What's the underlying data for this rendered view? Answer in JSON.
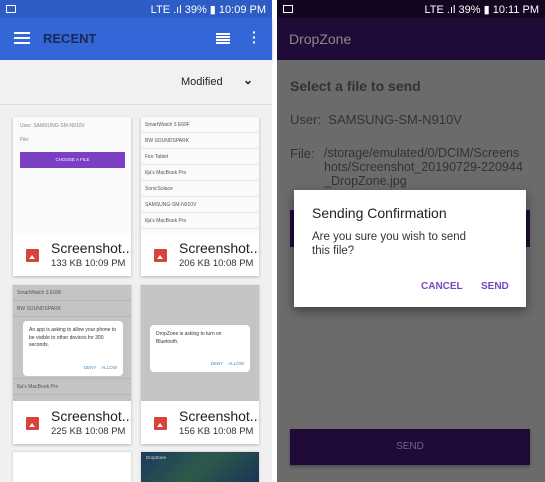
{
  "left": {
    "status": {
      "time": "10:09 PM",
      "battery": "39%",
      "network": "LTE"
    },
    "toolbar": {
      "title": "RECENT",
      "menu_icon": "hamburger-icon",
      "view_icon": "list-view-icon",
      "more_icon": "more-vert-icon"
    },
    "sort": {
      "label": "Modified"
    },
    "files": [
      {
        "name": "Screenshot...",
        "size": "133 KB",
        "time": "10:09 PM",
        "thumb": {
          "user": "User:",
          "user_value": "SAMSUNG-SM-N910V",
          "file": "File:",
          "button": "CHOOSE A FILE"
        }
      },
      {
        "name": "Screenshot...",
        "size": "206 KB",
        "time": "10:08 PM",
        "thumb": {
          "devices": [
            "SmartWatch 3 E69F",
            "BW SOUNDSPARK",
            "Fire Tablet",
            "Ilja's MacBook Pro",
            "SonicSolace",
            "SAMSUNG-SM-N910V",
            "Ilja's MacBook Pro"
          ]
        }
      },
      {
        "name": "Screenshot...",
        "size": "225 KB",
        "time": "10:08 PM",
        "thumb": {
          "devices": [
            "SmartWatch 3 E69F",
            "BW SOUNDSPARK",
            "Ilja's MacBook Pro"
          ],
          "dialog": "An app is asking to allow your phone to be visible to other devices for 300 seconds.",
          "deny": "DENY",
          "allow": "ALLOW"
        }
      },
      {
        "name": "Screenshot...",
        "size": "156 KB",
        "time": "10:08 PM",
        "thumb": {
          "dialog": "DropZone is asking to turn on Bluetooth.",
          "deny": "DENY",
          "allow": "ALLOW"
        }
      }
    ],
    "partial_thumb_title": "DropZone"
  },
  "right": {
    "status": {
      "time": "10:11 PM",
      "battery": "39%",
      "network": "LTE"
    },
    "app_title": "DropZone",
    "heading": "Select a file to send",
    "user_label": "User:",
    "user_value": "SAMSUNG-SM-N910V",
    "file_label": "File:",
    "file_value": "/storage/emulated/0/DCIM/Screenshots/Screenshot_20190729-220944_DropZone.jpg",
    "send_button": "SEND",
    "dialog": {
      "title": "Sending Confirmation",
      "message": "Are you sure you wish to send this file?",
      "cancel": "CANCEL",
      "confirm": "SEND"
    }
  }
}
